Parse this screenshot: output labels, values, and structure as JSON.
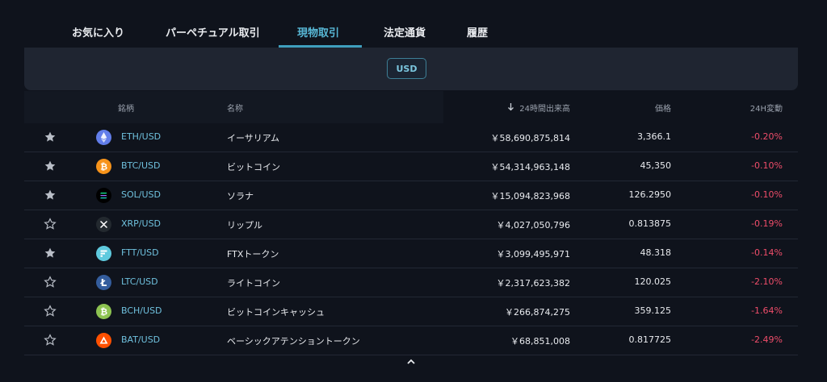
{
  "tabs": [
    {
      "label": "お気に入り"
    },
    {
      "label": "パーペチュアル取引"
    },
    {
      "label": "現物取引"
    },
    {
      "label": "法定通貨"
    },
    {
      "label": "履歴"
    }
  ],
  "active_tab": "現物取引",
  "currency_filter": {
    "label": "USD"
  },
  "table": {
    "headers": {
      "symbol": "銘柄",
      "name": "名称",
      "volume": "24時間出来高",
      "price": "価格",
      "change": "24H変動"
    },
    "sort_icon": "arrow-down-icon",
    "rows": [
      {
        "favorite": true,
        "icon": "eth-icon",
        "pair": "ETH/USD",
        "name": "イーサリアム",
        "volume": "￥58,690,875,814",
        "price": "3,366.1",
        "change": "-0.20%"
      },
      {
        "favorite": true,
        "icon": "btc-icon",
        "pair": "BTC/USD",
        "name": "ビットコイン",
        "volume": "￥54,314,963,148",
        "price": "45,350",
        "change": "-0.10%"
      },
      {
        "favorite": true,
        "icon": "sol-icon",
        "pair": "SOL/USD",
        "name": "ソラナ",
        "volume": "￥15,094,823,968",
        "price": "126.2950",
        "change": "-0.10%"
      },
      {
        "favorite": false,
        "icon": "xrp-icon",
        "pair": "XRP/USD",
        "name": "リップル",
        "volume": "￥4,027,050,796",
        "price": "0.813875",
        "change": "-0.19%"
      },
      {
        "favorite": true,
        "icon": "ftt-icon",
        "pair": "FTT/USD",
        "name": "FTXトークン",
        "volume": "￥3,099,495,971",
        "price": "48.318",
        "change": "-0.14%"
      },
      {
        "favorite": false,
        "icon": "ltc-icon",
        "pair": "LTC/USD",
        "name": "ライトコイン",
        "volume": "￥2,317,623,382",
        "price": "120.025",
        "change": "-2.10%"
      },
      {
        "favorite": false,
        "icon": "bch-icon",
        "pair": "BCH/USD",
        "name": "ビットコインキャッシュ",
        "volume": "￥266,874,275",
        "price": "359.125",
        "change": "-1.64%"
      },
      {
        "favorite": false,
        "icon": "bat-icon",
        "pair": "BAT/USD",
        "name": "ベーシックアテンショントークン",
        "volume": "￥68,851,008",
        "price": "0.817725",
        "change": "-2.49%"
      }
    ]
  },
  "colors": {
    "background": "#0f131c",
    "accent": "#58b8d6",
    "negative": "#ef4d6a",
    "pair_text": "#6fc0dd"
  },
  "collapse_icon": "chevron-up-icon"
}
